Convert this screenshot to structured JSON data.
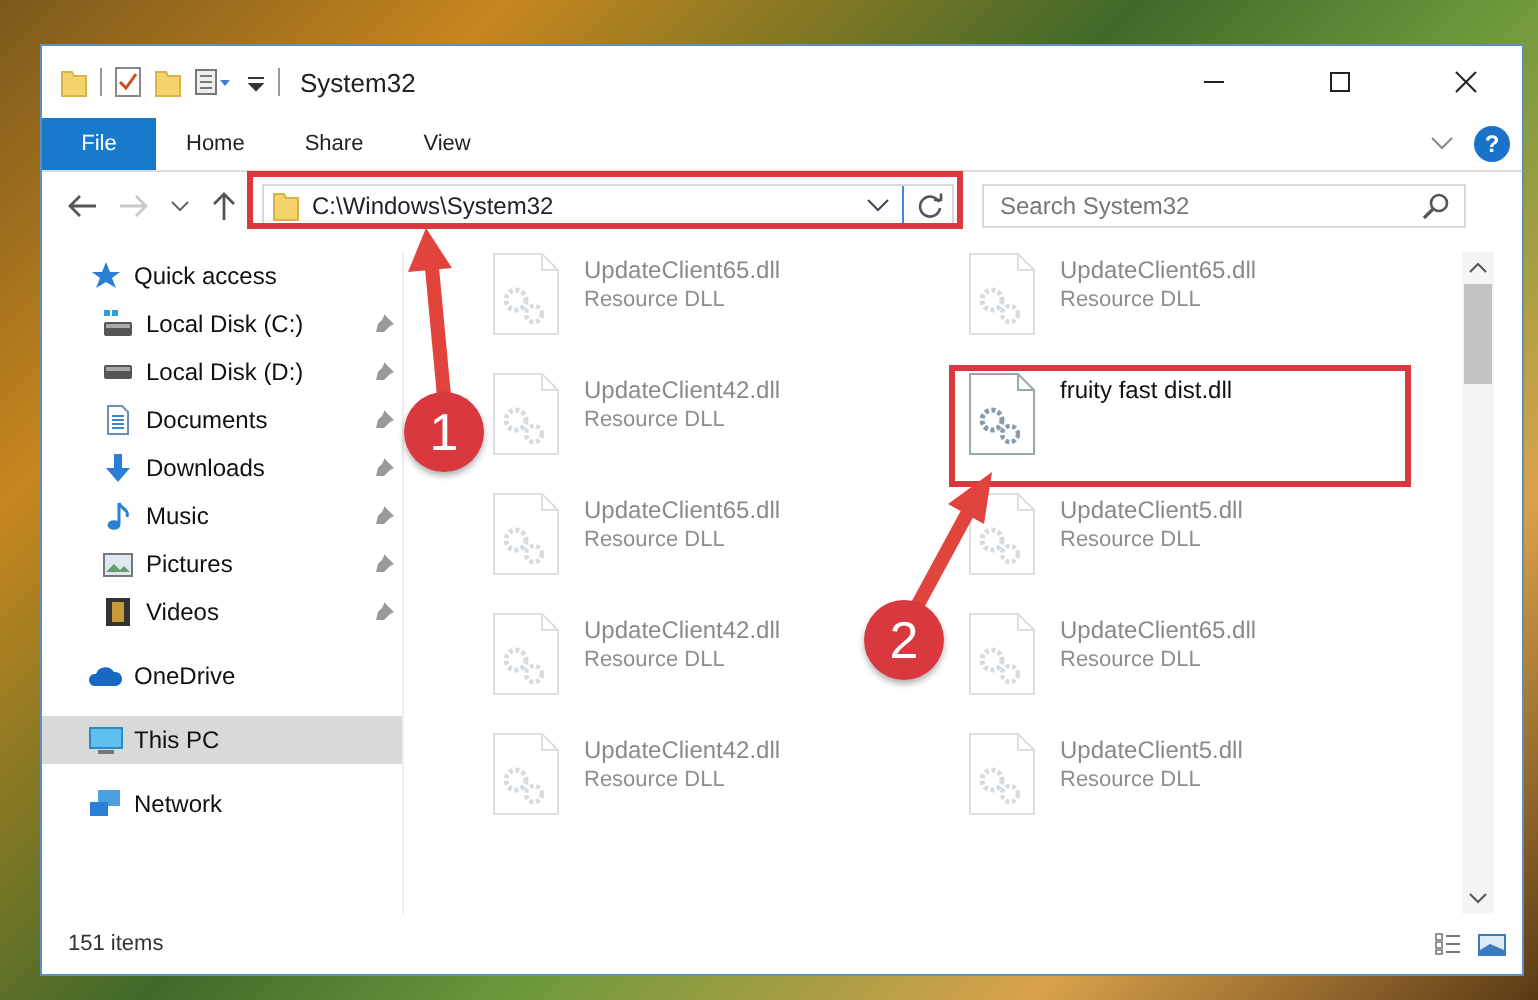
{
  "window": {
    "title": "System32"
  },
  "help_button": {
    "label": "?"
  },
  "ribbon_tabs": [
    {
      "label": "File",
      "kind": "file"
    },
    {
      "label": "Home",
      "kind": "tab"
    },
    {
      "label": "Share",
      "kind": "tab"
    },
    {
      "label": "View",
      "kind": "tab"
    }
  ],
  "address": {
    "path": "C:\\Windows\\System32"
  },
  "search": {
    "placeholder": "Search System32"
  },
  "navigation": [
    {
      "label": "Quick access",
      "kind": "star",
      "selected": false,
      "children": [
        {
          "label": "Local Disk (C:)",
          "kind": "drive-c",
          "selected": false,
          "pinned": true
        },
        {
          "label": "Local Disk (D:)",
          "kind": "drive",
          "selected": false,
          "pinned": true
        },
        {
          "label": "Documents",
          "kind": "documents",
          "selected": false,
          "pinned": true
        },
        {
          "label": "Downloads",
          "kind": "downloads",
          "selected": false,
          "pinned": true
        },
        {
          "label": "Music",
          "kind": "music",
          "selected": false,
          "pinned": true
        },
        {
          "label": "Pictures",
          "kind": "pictures",
          "selected": false,
          "pinned": true
        },
        {
          "label": "Videos",
          "kind": "videos",
          "selected": false,
          "pinned": true
        }
      ]
    },
    {
      "label": "OneDrive",
      "kind": "cloud",
      "selected": false
    },
    {
      "label": "This PC",
      "kind": "pc",
      "selected": true
    },
    {
      "label": "Network",
      "kind": "network",
      "selected": false
    }
  ],
  "files": [
    {
      "name": "UpdateClient65.dll",
      "type": "Resource DLL",
      "dimmed": true
    },
    {
      "name": "UpdateClient65.dll",
      "type": "Resource DLL",
      "dimmed": true
    },
    {
      "name": "UpdateClient42.dll",
      "type": "Resource DLL",
      "dimmed": true
    },
    {
      "name": "fruity fast dist.dll",
      "dimmed": false
    },
    {
      "name": "UpdateClient65.dll",
      "type": "Resource DLL",
      "dimmed": true
    },
    {
      "name": "UpdateClient5.dll",
      "type": "Resource DLL",
      "dimmed": true
    },
    {
      "name": "UpdateClient42.dll",
      "type": "Resource DLL",
      "dimmed": true
    },
    {
      "name": "UpdateClient65.dll",
      "type": "Resource DLL",
      "dimmed": true
    },
    {
      "name": "UpdateClient42.dll",
      "type": "Resource DLL",
      "dimmed": true
    },
    {
      "name": "UpdateClient5.dll",
      "type": "Resource DLL",
      "dimmed": true
    }
  ],
  "status_bar": {
    "item_count": "151 items"
  },
  "annotations": [
    {
      "label": "1"
    },
    {
      "label": "2"
    }
  ]
}
